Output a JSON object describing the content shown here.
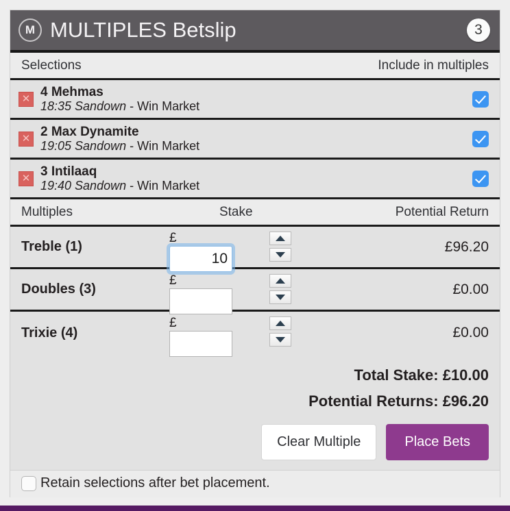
{
  "header": {
    "logo_icon": "circle-m-logo-icon",
    "title": "MULTIPLES Betslip",
    "count": "3",
    "bg_color": "#5d5a5e"
  },
  "selections_head": {
    "left": "Selections",
    "right": "Include in multiples"
  },
  "selections": [
    {
      "remove_icon": "remove-x-icon",
      "name": "4 Mehmas",
      "event": "18:35 Sandown",
      "market": " - Win Market",
      "included": true
    },
    {
      "remove_icon": "remove-x-icon",
      "name": "2 Max Dynamite",
      "event": "19:05 Sandown",
      "market": " - Win Market",
      "included": true
    },
    {
      "remove_icon": "remove-x-icon",
      "name": "3 Intilaaq",
      "event": "19:40 Sandown",
      "market": " - Win Market",
      "included": true
    }
  ],
  "multiples_head": {
    "left": "Multiples",
    "mid": "Stake",
    "right": "Potential Return"
  },
  "multiples": [
    {
      "name": "Treble (1)",
      "currency": "£",
      "stake": "10",
      "stake_placeholder": "",
      "focused": true,
      "potential_return": "£96.20"
    },
    {
      "name": "Doubles (3)",
      "currency": "£",
      "stake": "",
      "stake_placeholder": "",
      "focused": false,
      "potential_return": "£0.00"
    },
    {
      "name": "Trixie (4)",
      "currency": "£",
      "stake": "",
      "stake_placeholder": "",
      "focused": false,
      "potential_return": "£0.00"
    }
  ],
  "totals": {
    "total_stake": "Total Stake: £10.00",
    "potential_returns": "Potential Returns: £96.20"
  },
  "actions": {
    "clear_label": "Clear Multiple",
    "place_label": "Place Bets",
    "place_color": "#8e3a8e"
  },
  "retain": {
    "label": "Retain selections after bet placement.",
    "checked": false
  },
  "colors": {
    "header_bg": "#5d5a5e",
    "row_bg": "#e2e2e2",
    "accent_purple": "#8e3a8e",
    "checkbox_blue": "#3c95f2",
    "remove_red": "#d9625e"
  }
}
